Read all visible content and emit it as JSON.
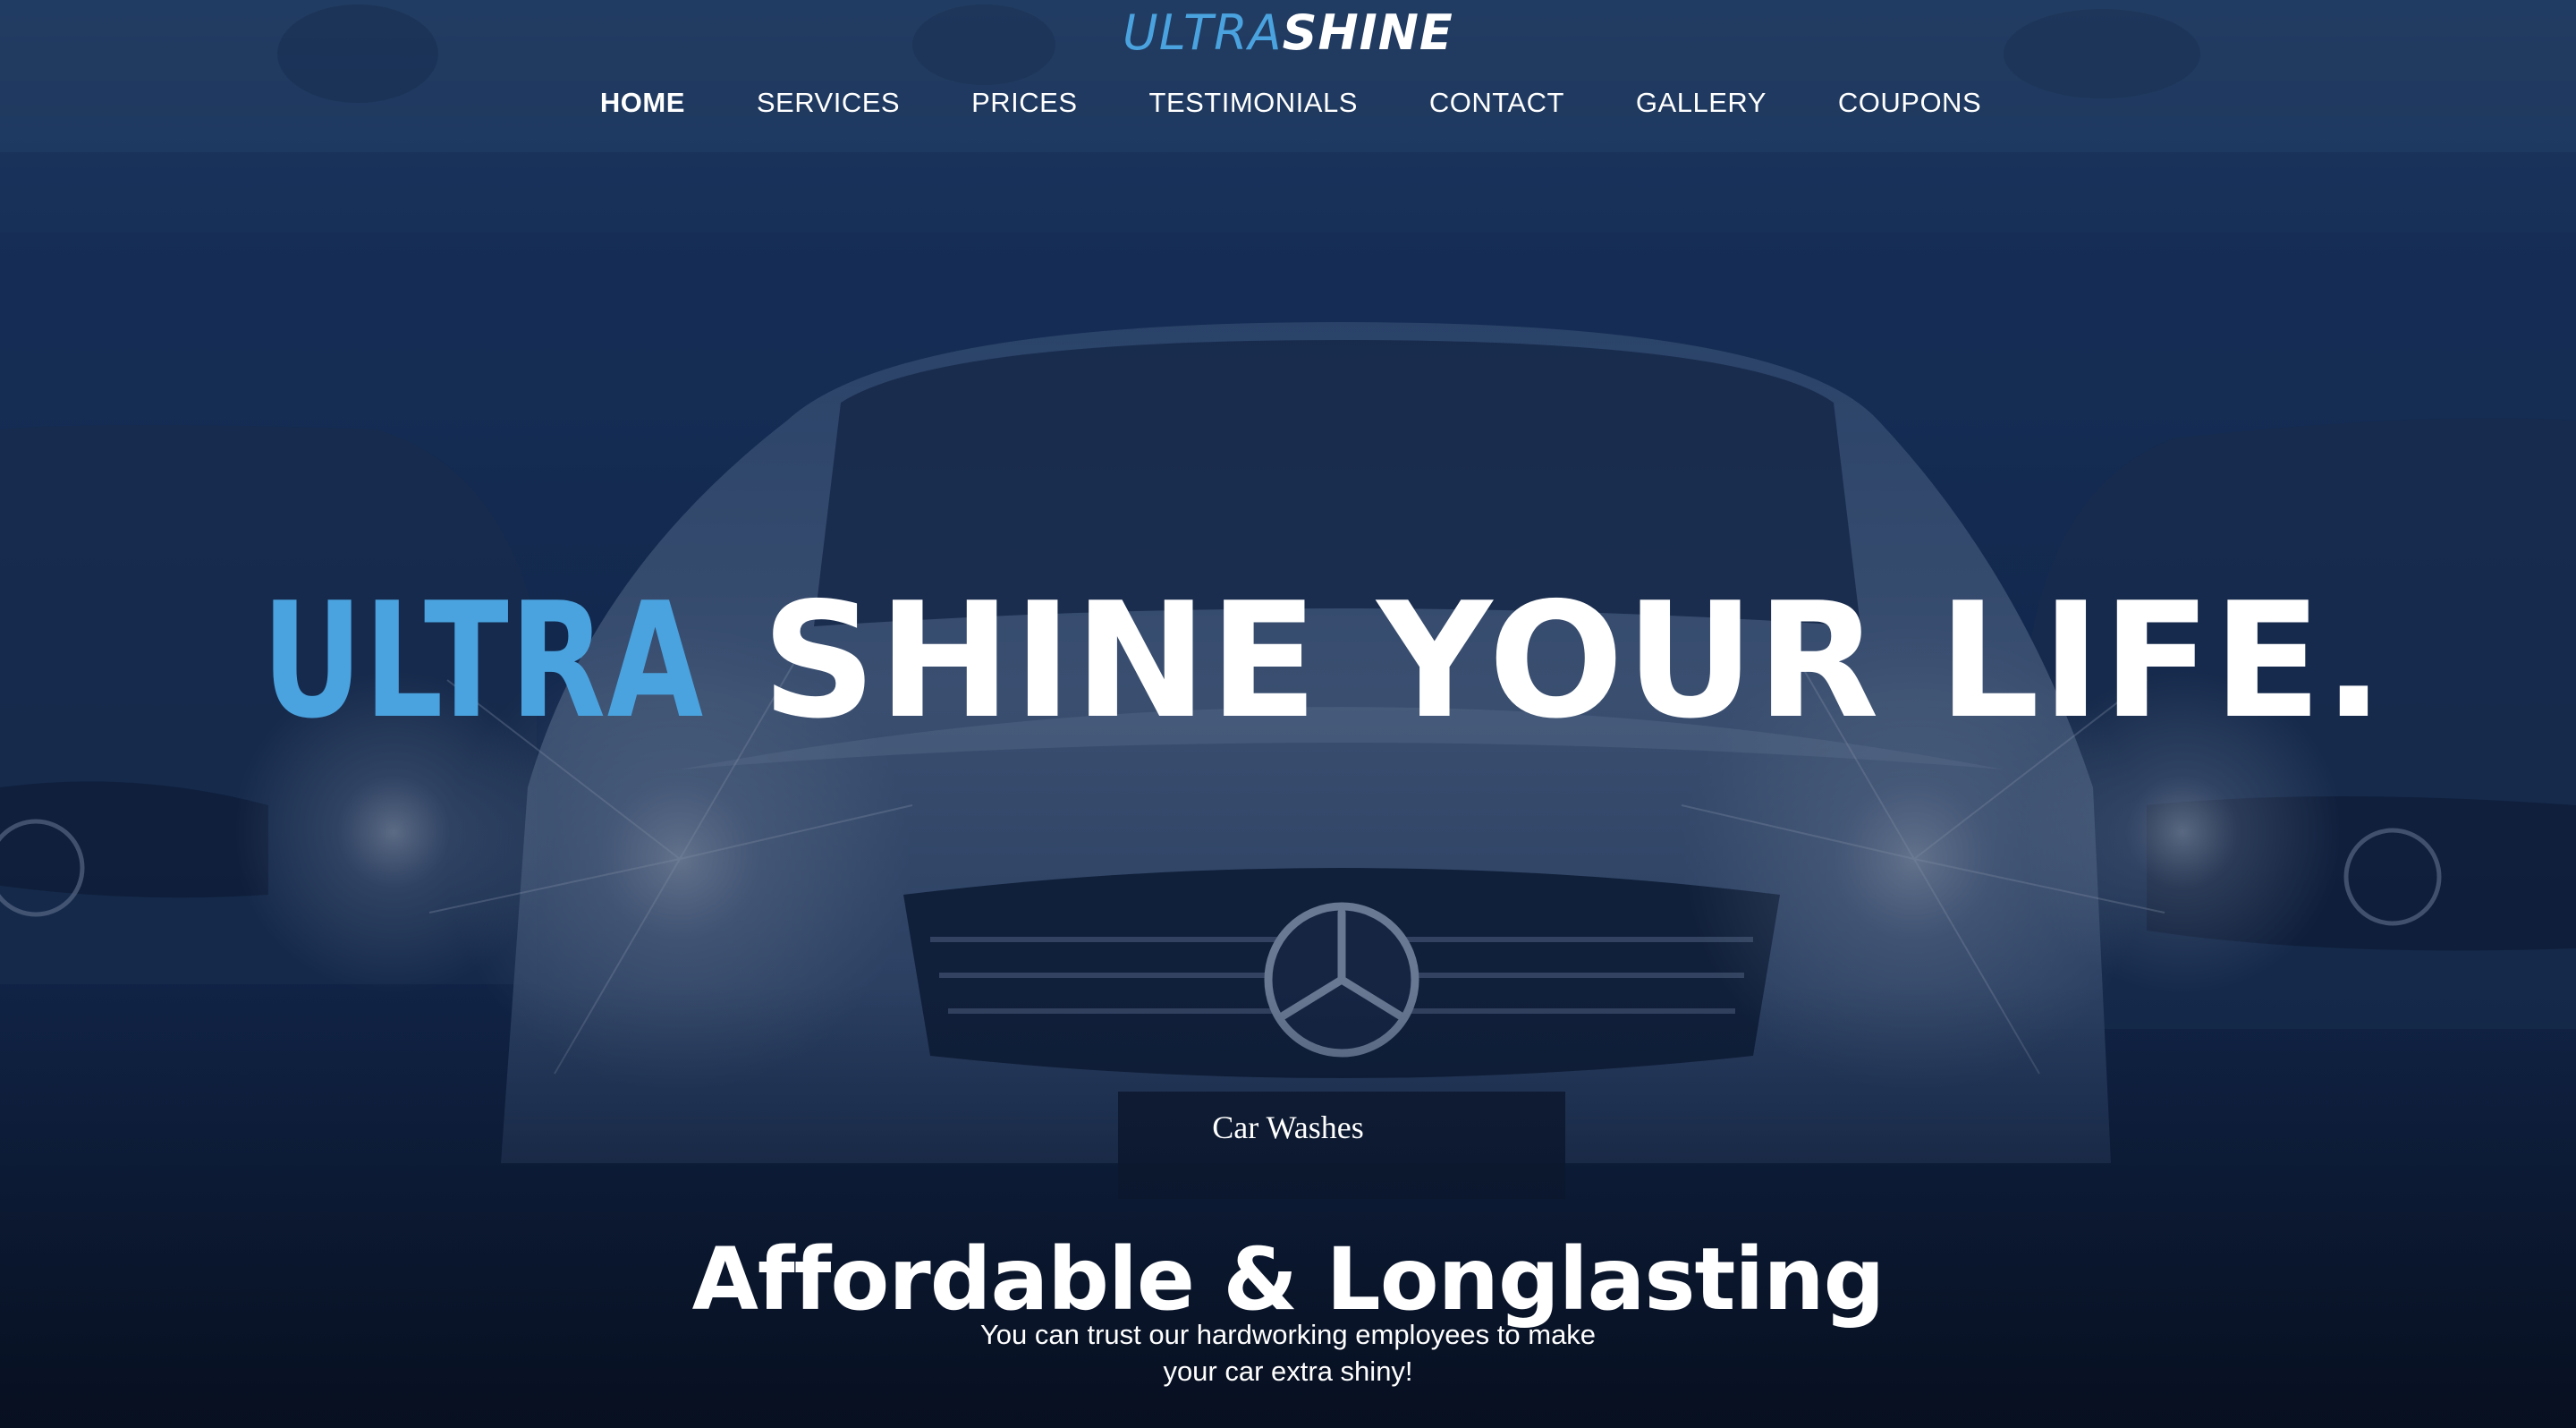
{
  "header": {
    "logo_ultra": "ULTRA",
    "logo_shine": "SHINE",
    "nav": [
      {
        "label": "HOME",
        "active": true
      },
      {
        "label": "SERVICES",
        "active": false
      },
      {
        "label": "PRICES",
        "active": false
      },
      {
        "label": "TESTIMONIALS",
        "active": false
      },
      {
        "label": "CONTACT",
        "active": false
      },
      {
        "label": "GALLERY",
        "active": false
      },
      {
        "label": "COUPONS",
        "active": false
      }
    ]
  },
  "hero": {
    "headline_accent": "ULTRA",
    "headline_rest": "SHINE YOUR LIFE",
    "headline_period": ".",
    "eyebrow": "Car Washes",
    "subhead": "Affordable & Longlasting",
    "body": "You can trust our hardworking employees to make your car extra shiny!"
  },
  "colors": {
    "accent": "#4aa3df",
    "overlay": "#0f2347",
    "text": "#ffffff"
  }
}
